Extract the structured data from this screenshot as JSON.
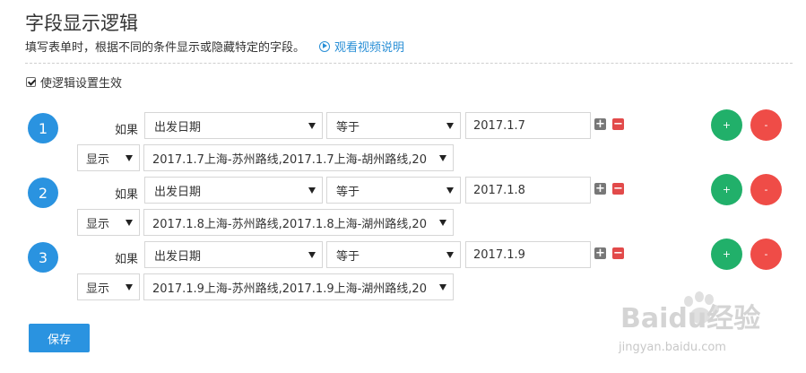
{
  "header": {
    "title": "字段显示逻辑",
    "subtitle": "填写表单时，根据不同的条件显示或隐藏特定的字段。",
    "video_link": "观看视频说明"
  },
  "enable_logic": {
    "label": "使逻辑设置生效",
    "checked": true
  },
  "rules": [
    {
      "number": "1",
      "if_label": "如果",
      "field": "出发日期",
      "operator": "等于",
      "value": "2017.1.7",
      "action": "显示",
      "targets": "2017.1.7上海-苏州路线,2017.1.7上海-胡州路线,20",
      "add_label": "+",
      "remove_label": "-"
    },
    {
      "number": "2",
      "if_label": "如果",
      "field": "出发日期",
      "operator": "等于",
      "value": "2017.1.8",
      "action": "显示",
      "targets": "2017.1.8上海-苏州路线,2017.1.8上海-湖州路线,20",
      "add_label": "+",
      "remove_label": "-"
    },
    {
      "number": "3",
      "if_label": "如果",
      "field": "出发日期",
      "operator": "等于",
      "value": "2017.1.9",
      "action": "显示",
      "targets": "2017.1.9上海-苏州路线,2017.1.9上海-湖州路线,20",
      "add_label": "+",
      "remove_label": "-"
    }
  ],
  "save_label": "保存",
  "watermark": {
    "text": "Baidu经验",
    "url": "jingyan.baidu.com"
  },
  "colors": {
    "accent": "#2a93e0",
    "add": "#21b06a",
    "remove": "#ef4c47"
  }
}
